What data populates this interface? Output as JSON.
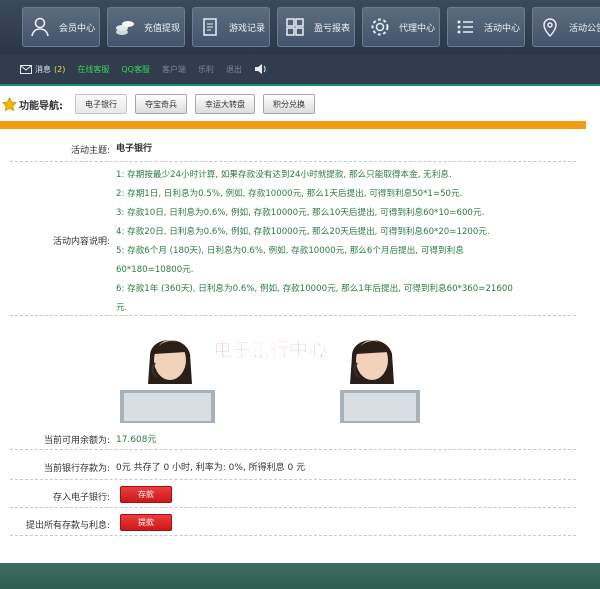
{
  "topnav": {
    "items": [
      {
        "label": "会员中心",
        "icon": "user-icon"
      },
      {
        "label": "充值提现",
        "icon": "coins-icon"
      },
      {
        "label": "游戏记录",
        "icon": "document-icon"
      },
      {
        "label": "盈亏报表",
        "icon": "grid-icon"
      },
      {
        "label": "代理中心",
        "icon": "gear-icon"
      },
      {
        "label": "活动中心",
        "icon": "list-icon"
      },
      {
        "label": "活动公告",
        "icon": "map-pin-icon"
      }
    ]
  },
  "statusbar": {
    "message_label": "消息",
    "message_count": "(2)",
    "online_service": "在线客服",
    "qq_service": "QQ客服",
    "client": "客户端",
    "item4": "乐利",
    "logout": "退出"
  },
  "funcnav": {
    "label": "功能导航:",
    "tabs": [
      "电子银行",
      "夺宝奇兵",
      "幸运大转盘",
      "积分兑换"
    ]
  },
  "activity": {
    "theme_label": "活动主题:",
    "theme_value": "电子银行",
    "desc_label": "活动内容说明:",
    "desc_lines": [
      "1: 存期按最少24小时计算, 如果存款没有达到24小时就提款, 那么只能取得本金, 无利息.",
      "2: 存期1日, 日利息为0.5%, 例如, 存款10000元, 那么1天后提出, 可得到利息50*1=50元.",
      "3: 存款10日, 日利息为0.6%, 例如, 存款10000元, 那么10天后提出, 可得到利息60*10=600元.",
      "4: 存款20日, 日利息为0.6%, 例如, 存款10000元, 那么20天后提出, 可得到利息60*20=1200元.",
      "5: 存款6个月 (180天), 日利息为0.6%, 例如, 存款10000元, 那么6个月后提出, 可得到利息",
      "60*180=10800元.",
      "6: 存款1年 (360天), 日利息为0.6%, 例如, 存款10000元, 那么1年后提出, 可得到利息60*360=21600",
      "元."
    ],
    "banner_title": "电子银行中心"
  },
  "account": {
    "balance_label": "当前可用余额为:",
    "balance_value": "17.608元",
    "deposit_label": "当前银行存款为:",
    "deposit_value": "0元  共存了 0 小时, 利率为: 0%, 所得利息 0 元",
    "deposit_action_label": "存入电子银行:",
    "deposit_button": "存款",
    "withdraw_action_label": "提出所有存款与利息:",
    "withdraw_button": "提款"
  },
  "colors": {
    "accent": "#f39c12",
    "desc_text": "#2c7a46",
    "theme_text": "#c0392b",
    "button_red": "#d82020"
  }
}
